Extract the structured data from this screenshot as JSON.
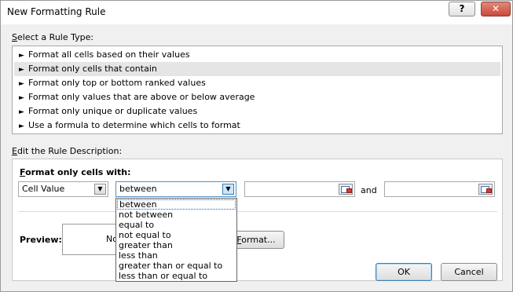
{
  "window": {
    "title": "New Formatting Rule",
    "help_label": "?",
    "close_label": "✕"
  },
  "rule_type": {
    "label_prefix": "",
    "label_accel": "S",
    "label_rest": "elect a Rule Type:",
    "arrow_glyph": "►",
    "items": [
      {
        "label": "Format all cells based on their values",
        "selected": false
      },
      {
        "label": "Format only cells that contain",
        "selected": true
      },
      {
        "label": "Format only top or bottom ranked values",
        "selected": false
      },
      {
        "label": "Format only values that are above or below average",
        "selected": false
      },
      {
        "label": "Format only unique or duplicate values",
        "selected": false
      },
      {
        "label": "Use a formula to determine which cells to format",
        "selected": false
      }
    ]
  },
  "description": {
    "label_accel": "E",
    "label_rest": "dit the Rule Description:",
    "heading_accel": "F",
    "heading_rest": "ormat only cells with:",
    "cell_type": {
      "value": "Cell Value",
      "drop_glyph": "▼"
    },
    "operator": {
      "value": "between",
      "drop_glyph": "▼"
    },
    "value1": "",
    "and_label": "and",
    "value2": ""
  },
  "operator_options": [
    {
      "label": "between",
      "selected": true
    },
    {
      "label": "not between",
      "selected": false
    },
    {
      "label": "equal to",
      "selected": false
    },
    {
      "label": "not equal to",
      "selected": false
    },
    {
      "label": "greater than",
      "selected": false
    },
    {
      "label": "less than",
      "selected": false
    },
    {
      "label": "greater than or equal to",
      "selected": false
    },
    {
      "label": "less than or equal to",
      "selected": false
    }
  ],
  "preview": {
    "label": "Preview:",
    "sample_text": "No",
    "format_button_accel": "F",
    "format_button_rest": "ormat..."
  },
  "footer": {
    "ok_label": "OK",
    "cancel_label": "Cancel"
  },
  "colors": {
    "selection_row": "#e5e5e5",
    "focus_border": "#1a5fb4",
    "dialog_bg": "#f0f0f0"
  }
}
